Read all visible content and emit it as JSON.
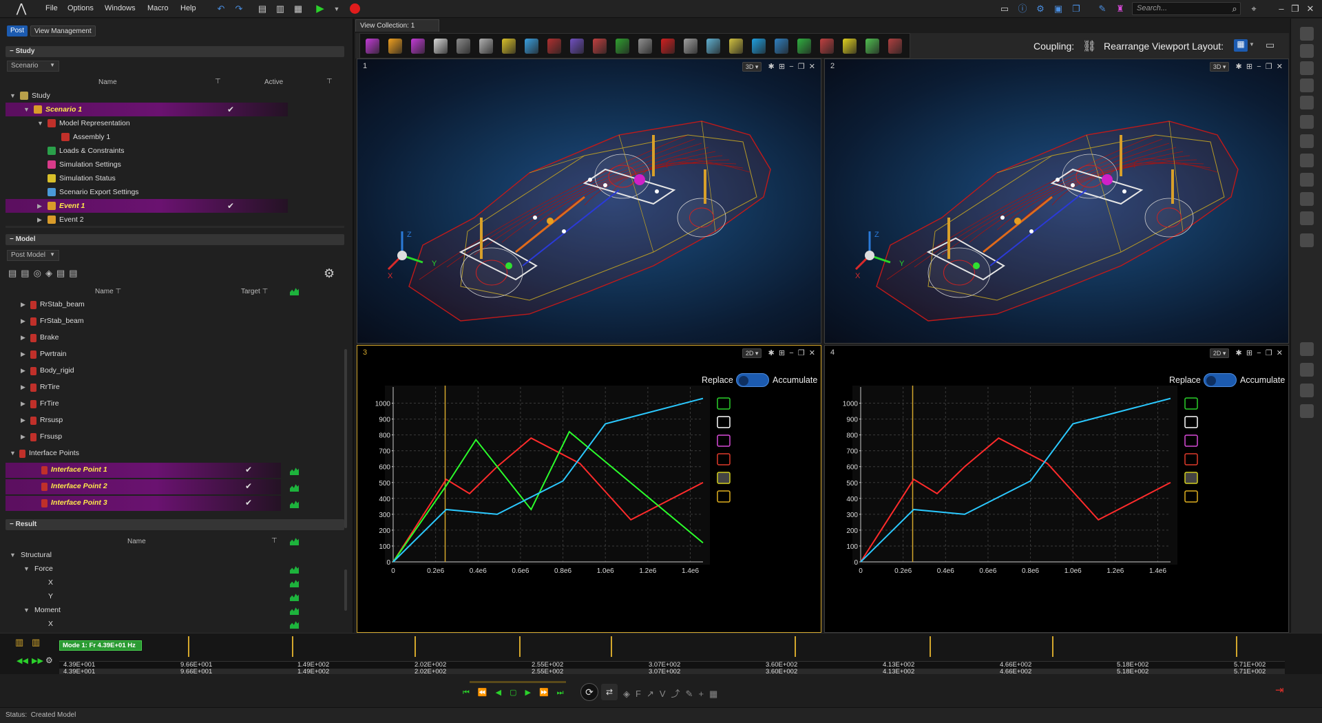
{
  "app": {
    "menu": [
      "File",
      "Options",
      "Windows",
      "Macro",
      "Help"
    ],
    "search_placeholder": "Search..."
  },
  "left": {
    "tabs": [
      "Post",
      "View Management"
    ],
    "study": {
      "header": "Study",
      "dropdown": "Scenario",
      "col_name": "Name",
      "col_active": "Active",
      "rows": [
        {
          "label": "Study",
          "indent": 0,
          "arrow": "▼",
          "icon": "#b8a04a",
          "hl": false,
          "check": false
        },
        {
          "label": "Scenario 1",
          "indent": 1,
          "arrow": "▼",
          "icon": "#d99b2a",
          "hl": true,
          "check": true
        },
        {
          "label": "Model Representation",
          "indent": 2,
          "arrow": "▼",
          "icon": "#c0302a",
          "hl": false,
          "check": false
        },
        {
          "label": "Assembly 1",
          "indent": 3,
          "arrow": "",
          "icon": "#c0302a",
          "hl": false,
          "check": false
        },
        {
          "label": "Loads & Constraints",
          "indent": 2,
          "arrow": "",
          "icon": "#2aa04a",
          "hl": false,
          "check": false
        },
        {
          "label": "Simulation Settings",
          "indent": 2,
          "arrow": "",
          "icon": "#d83b8a",
          "hl": false,
          "check": false
        },
        {
          "label": "Simulation Status",
          "indent": 2,
          "arrow": "",
          "icon": "#d8c02a",
          "hl": false,
          "check": false
        },
        {
          "label": "Scenario Export Settings",
          "indent": 2,
          "arrow": "",
          "icon": "#4a9ad8",
          "hl": false,
          "check": false
        },
        {
          "label": "Event 1",
          "indent": 2,
          "arrow": "▶",
          "icon": "#d99b2a",
          "hl": true,
          "check": true
        },
        {
          "label": "Event 2",
          "indent": 2,
          "arrow": "▶",
          "icon": "#d99b2a",
          "hl": false,
          "check": false
        }
      ]
    },
    "model": {
      "header": "Model",
      "dropdown": "Post Model",
      "col_name": "Name",
      "col_target": "Target",
      "rows": [
        {
          "label": "RrStab_beam",
          "indent": 1,
          "hl": false,
          "check": false,
          "spark": false,
          "arrow": "▶"
        },
        {
          "label": "FrStab_beam",
          "indent": 1,
          "hl": false,
          "check": false,
          "spark": false,
          "arrow": "▶"
        },
        {
          "label": "Brake",
          "indent": 1,
          "hl": false,
          "check": false,
          "spark": false,
          "arrow": "▶"
        },
        {
          "label": "Pwrtrain",
          "indent": 1,
          "hl": false,
          "check": false,
          "spark": false,
          "arrow": "▶"
        },
        {
          "label": "Body_rigid",
          "indent": 1,
          "hl": false,
          "check": false,
          "spark": false,
          "arrow": "▶"
        },
        {
          "label": "RrTire",
          "indent": 1,
          "hl": false,
          "check": false,
          "spark": false,
          "arrow": "▶"
        },
        {
          "label": "FrTire",
          "indent": 1,
          "hl": false,
          "check": false,
          "spark": false,
          "arrow": "▶"
        },
        {
          "label": "Rrsusp",
          "indent": 1,
          "hl": false,
          "check": false,
          "spark": false,
          "arrow": "▶"
        },
        {
          "label": "Frsusp",
          "indent": 1,
          "hl": false,
          "check": false,
          "spark": false,
          "arrow": "▶"
        },
        {
          "label": "Interface Points",
          "indent": 0,
          "hl": false,
          "check": false,
          "spark": false,
          "arrow": "▼"
        },
        {
          "label": "Interface Point 1",
          "indent": 2,
          "hl": true,
          "check": true,
          "spark": true,
          "arrow": ""
        },
        {
          "label": "Interface Point 2",
          "indent": 2,
          "hl": true,
          "check": true,
          "spark": true,
          "arrow": ""
        },
        {
          "label": "Interface Point 3",
          "indent": 2,
          "hl": true,
          "check": true,
          "spark": true,
          "arrow": ""
        }
      ]
    },
    "result": {
      "header": "Result",
      "col_name": "Name",
      "rows": [
        {
          "label": "Structural",
          "indent": 0,
          "arrow": "▼",
          "spark": false
        },
        {
          "label": "Force",
          "indent": 1,
          "arrow": "▼",
          "spark": true
        },
        {
          "label": "X",
          "indent": 2,
          "arrow": "",
          "spark": true
        },
        {
          "label": "Y",
          "indent": 2,
          "arrow": "",
          "spark": true
        },
        {
          "label": "Moment",
          "indent": 1,
          "arrow": "▼",
          "spark": true
        },
        {
          "label": "X",
          "indent": 2,
          "arrow": "",
          "spark": true
        }
      ]
    }
  },
  "viewport": {
    "tab": "View Collection: 1",
    "coupling_label": "Coupling:",
    "rearrange_label": "Rearrange Viewport Layout:",
    "replace_label": "Replace",
    "accumulate_label": "Accumulate",
    "panels": [
      {
        "num": "1",
        "mode": "3D"
      },
      {
        "num": "2",
        "mode": "3D"
      },
      {
        "num": "3",
        "mode": "2D"
      },
      {
        "num": "4",
        "mode": "2D"
      }
    ],
    "axis_labels": {
      "x": "X",
      "y": "Y",
      "z": "Z"
    }
  },
  "chart_data": [
    {
      "type": "line",
      "title": "",
      "xlabel": "",
      "ylabel": "",
      "xlim": [
        0,
        1460000
      ],
      "ylim": [
        0,
        1050
      ],
      "x_ticks": [
        "0",
        "0.2e6",
        "0.4e6",
        "0.6e6",
        "0.8e6",
        "1.0e6",
        "1.2e6",
        "1.4e6"
      ],
      "y_ticks": [
        "0",
        "100",
        "200",
        "300",
        "400",
        "500",
        "600",
        "700",
        "800",
        "900",
        "1000"
      ],
      "cursor_x": 245000,
      "series": [
        {
          "color": "#ff2b2b",
          "x": [
            0,
            250000,
            360000,
            490000,
            650000,
            880000,
            1120000,
            1460000
          ],
          "y": [
            0,
            520,
            430,
            600,
            780,
            620,
            265,
            500
          ]
        },
        {
          "color": "#2bff2b",
          "x": [
            0,
            250000,
            390000,
            650000,
            830000,
            1460000
          ],
          "y": [
            0,
            480,
            770,
            330,
            820,
            120
          ]
        },
        {
          "color": "#2bc9ff",
          "x": [
            0,
            250000,
            490000,
            800000,
            1000000,
            1460000
          ],
          "y": [
            0,
            330,
            300,
            510,
            870,
            1030
          ]
        }
      ]
    },
    {
      "type": "line",
      "title": "",
      "xlabel": "",
      "ylabel": "",
      "xlim": [
        0,
        1460000
      ],
      "ylim": [
        0,
        1050
      ],
      "x_ticks": [
        "0",
        "0.2e6",
        "0.4e6",
        "0.6e6",
        "0.8e6",
        "1.0e6",
        "1.2e6",
        "1.4e6"
      ],
      "y_ticks": [
        "0",
        "100",
        "200",
        "300",
        "400",
        "500",
        "600",
        "700",
        "800",
        "900",
        "1000"
      ],
      "cursor_x": 245000,
      "series": [
        {
          "color": "#ff2b2b",
          "x": [
            0,
            250000,
            360000,
            490000,
            650000,
            880000,
            1120000,
            1460000
          ],
          "y": [
            0,
            520,
            430,
            600,
            780,
            620,
            265,
            500
          ]
        },
        {
          "color": "#2bc9ff",
          "x": [
            0,
            250000,
            490000,
            800000,
            1000000,
            1460000
          ],
          "y": [
            0,
            330,
            300,
            510,
            870,
            1030
          ]
        }
      ]
    }
  ],
  "timeline": {
    "mode_label": "Mode 1: Fr 4.39E+01 Hz",
    "values": [
      "4.39E+001",
      "9.66E+001",
      "1.49E+002",
      "2.02E+002",
      "2.55E+002",
      "3.07E+002",
      "3.60E+002",
      "4.13E+002",
      "4.66E+002",
      "5.18E+002",
      "5.71E+002"
    ],
    "marker_fractions": [
      0.105,
      0.19,
      0.29,
      0.375,
      0.45,
      0.6,
      0.71,
      0.81,
      0.96
    ]
  },
  "status": {
    "label": "Status:",
    "text": "Created Model"
  },
  "colors": {
    "highlight": "#5b0f5f",
    "accent": "#1c5bb0",
    "spark": "#1db33c",
    "cursor": "#d4a72c",
    "active_border": "#d4a72c"
  }
}
